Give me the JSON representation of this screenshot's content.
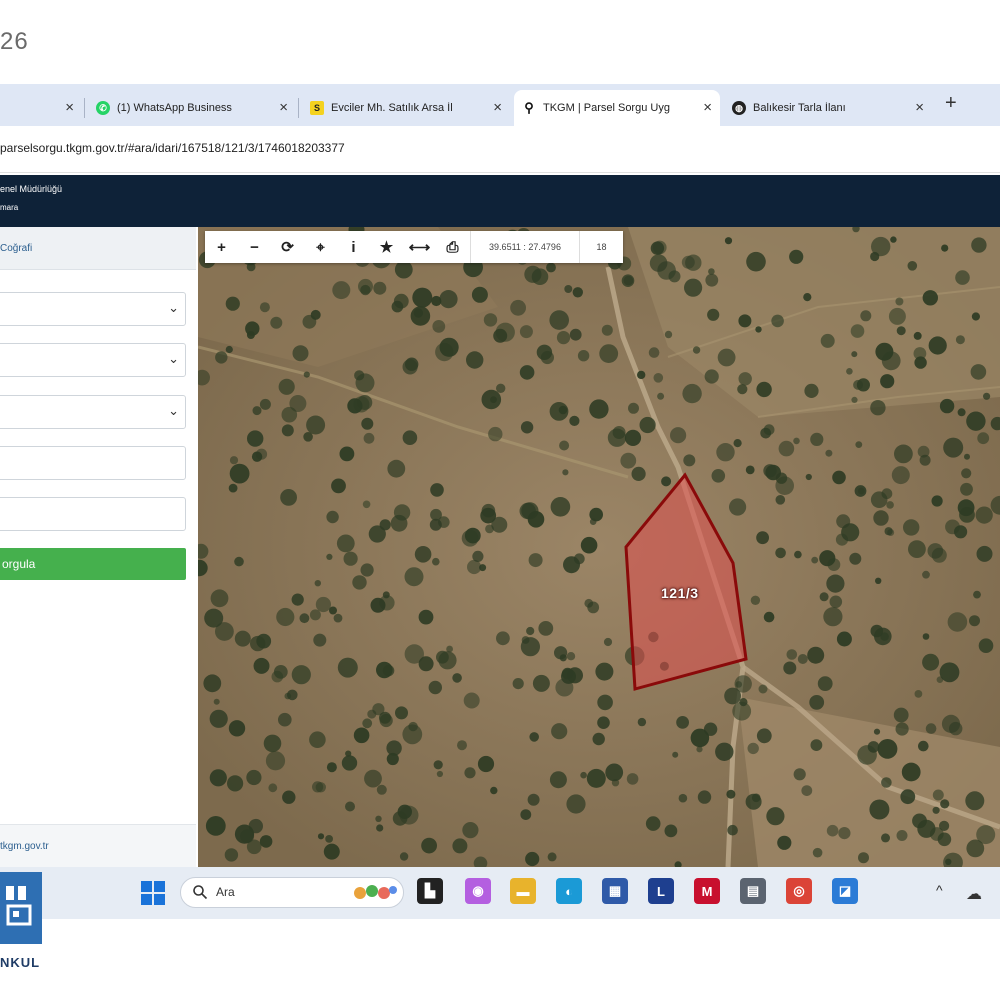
{
  "photo_caption": "26",
  "browser": {
    "tabs": [
      {
        "label": "",
        "icon": "blank-tab-icon",
        "active": false
      },
      {
        "label": "(1) WhatsApp Business",
        "icon": "whatsapp-icon",
        "active": false
      },
      {
        "label": "Evciler Mh. Satılık Arsa İl",
        "icon": "sahibinden-icon",
        "active": false
      },
      {
        "label": "TKGM | Parsel Sorgu Uyg",
        "icon": "location-pin-icon",
        "active": true
      },
      {
        "label": "Balıkesir Tarla İlanı",
        "icon": "circle-globe-icon",
        "active": false
      }
    ],
    "new_tab_symbol": "+",
    "close_symbol": "×",
    "url": "parselsorgu.tkgm.gov.tr/#ara/idari/167518/121/3/1746018203377"
  },
  "site_header": {
    "org_name": "enel Müdürlüğü",
    "org_sub": "mara"
  },
  "left_panel": {
    "tab_label": "Coğrafi",
    "chevron_symbol": "⌄",
    "query_button_label": "orgula",
    "footer_link": "tkgm.gov.tr"
  },
  "map": {
    "toolbar_symbols": [
      "+",
      "−",
      "⟳",
      "⌖",
      "i",
      "★",
      "⟷",
      "⎙"
    ],
    "coordinates": "39.6511 : 27.4796",
    "zoom_level": "18",
    "parcel_label": "121/3",
    "colors": {
      "parcel_fill": "#e05050",
      "parcel_stroke": "#8a0a0a",
      "ground": "#8c7658",
      "tree": "#2e3b24"
    }
  },
  "taskbar": {
    "search_text": "Ara",
    "tray_chevron": "^",
    "tray_cloud": "☁",
    "apps": [
      {
        "name": "file-explorer-dark-icon",
        "glyph": "▙",
        "color": "#222222"
      },
      {
        "name": "copilot-icon",
        "glyph": "◉",
        "color": "#b45fe0"
      },
      {
        "name": "file-explorer-icon",
        "glyph": "▬",
        "color": "#e8b32c"
      },
      {
        "name": "edge-icon",
        "glyph": "◐",
        "color": "#1b9ad6"
      },
      {
        "name": "microsoft-store-icon",
        "glyph": "▦",
        "color": "#2f5aa8"
      },
      {
        "name": "letter-l-app-icon",
        "glyph": "L",
        "color": "#1e3f8f"
      },
      {
        "name": "mcafee-icon",
        "glyph": "M",
        "color": "#c8102e"
      },
      {
        "name": "calculator-icon",
        "glyph": "▤",
        "color": "#5b6470"
      },
      {
        "name": "chrome-icon",
        "glyph": "◎",
        "color": "#db4437"
      },
      {
        "name": "photos-icon",
        "glyph": "◪",
        "color": "#2b7bd6"
      }
    ]
  },
  "watermark_logo": {
    "text": "NKUL"
  }
}
